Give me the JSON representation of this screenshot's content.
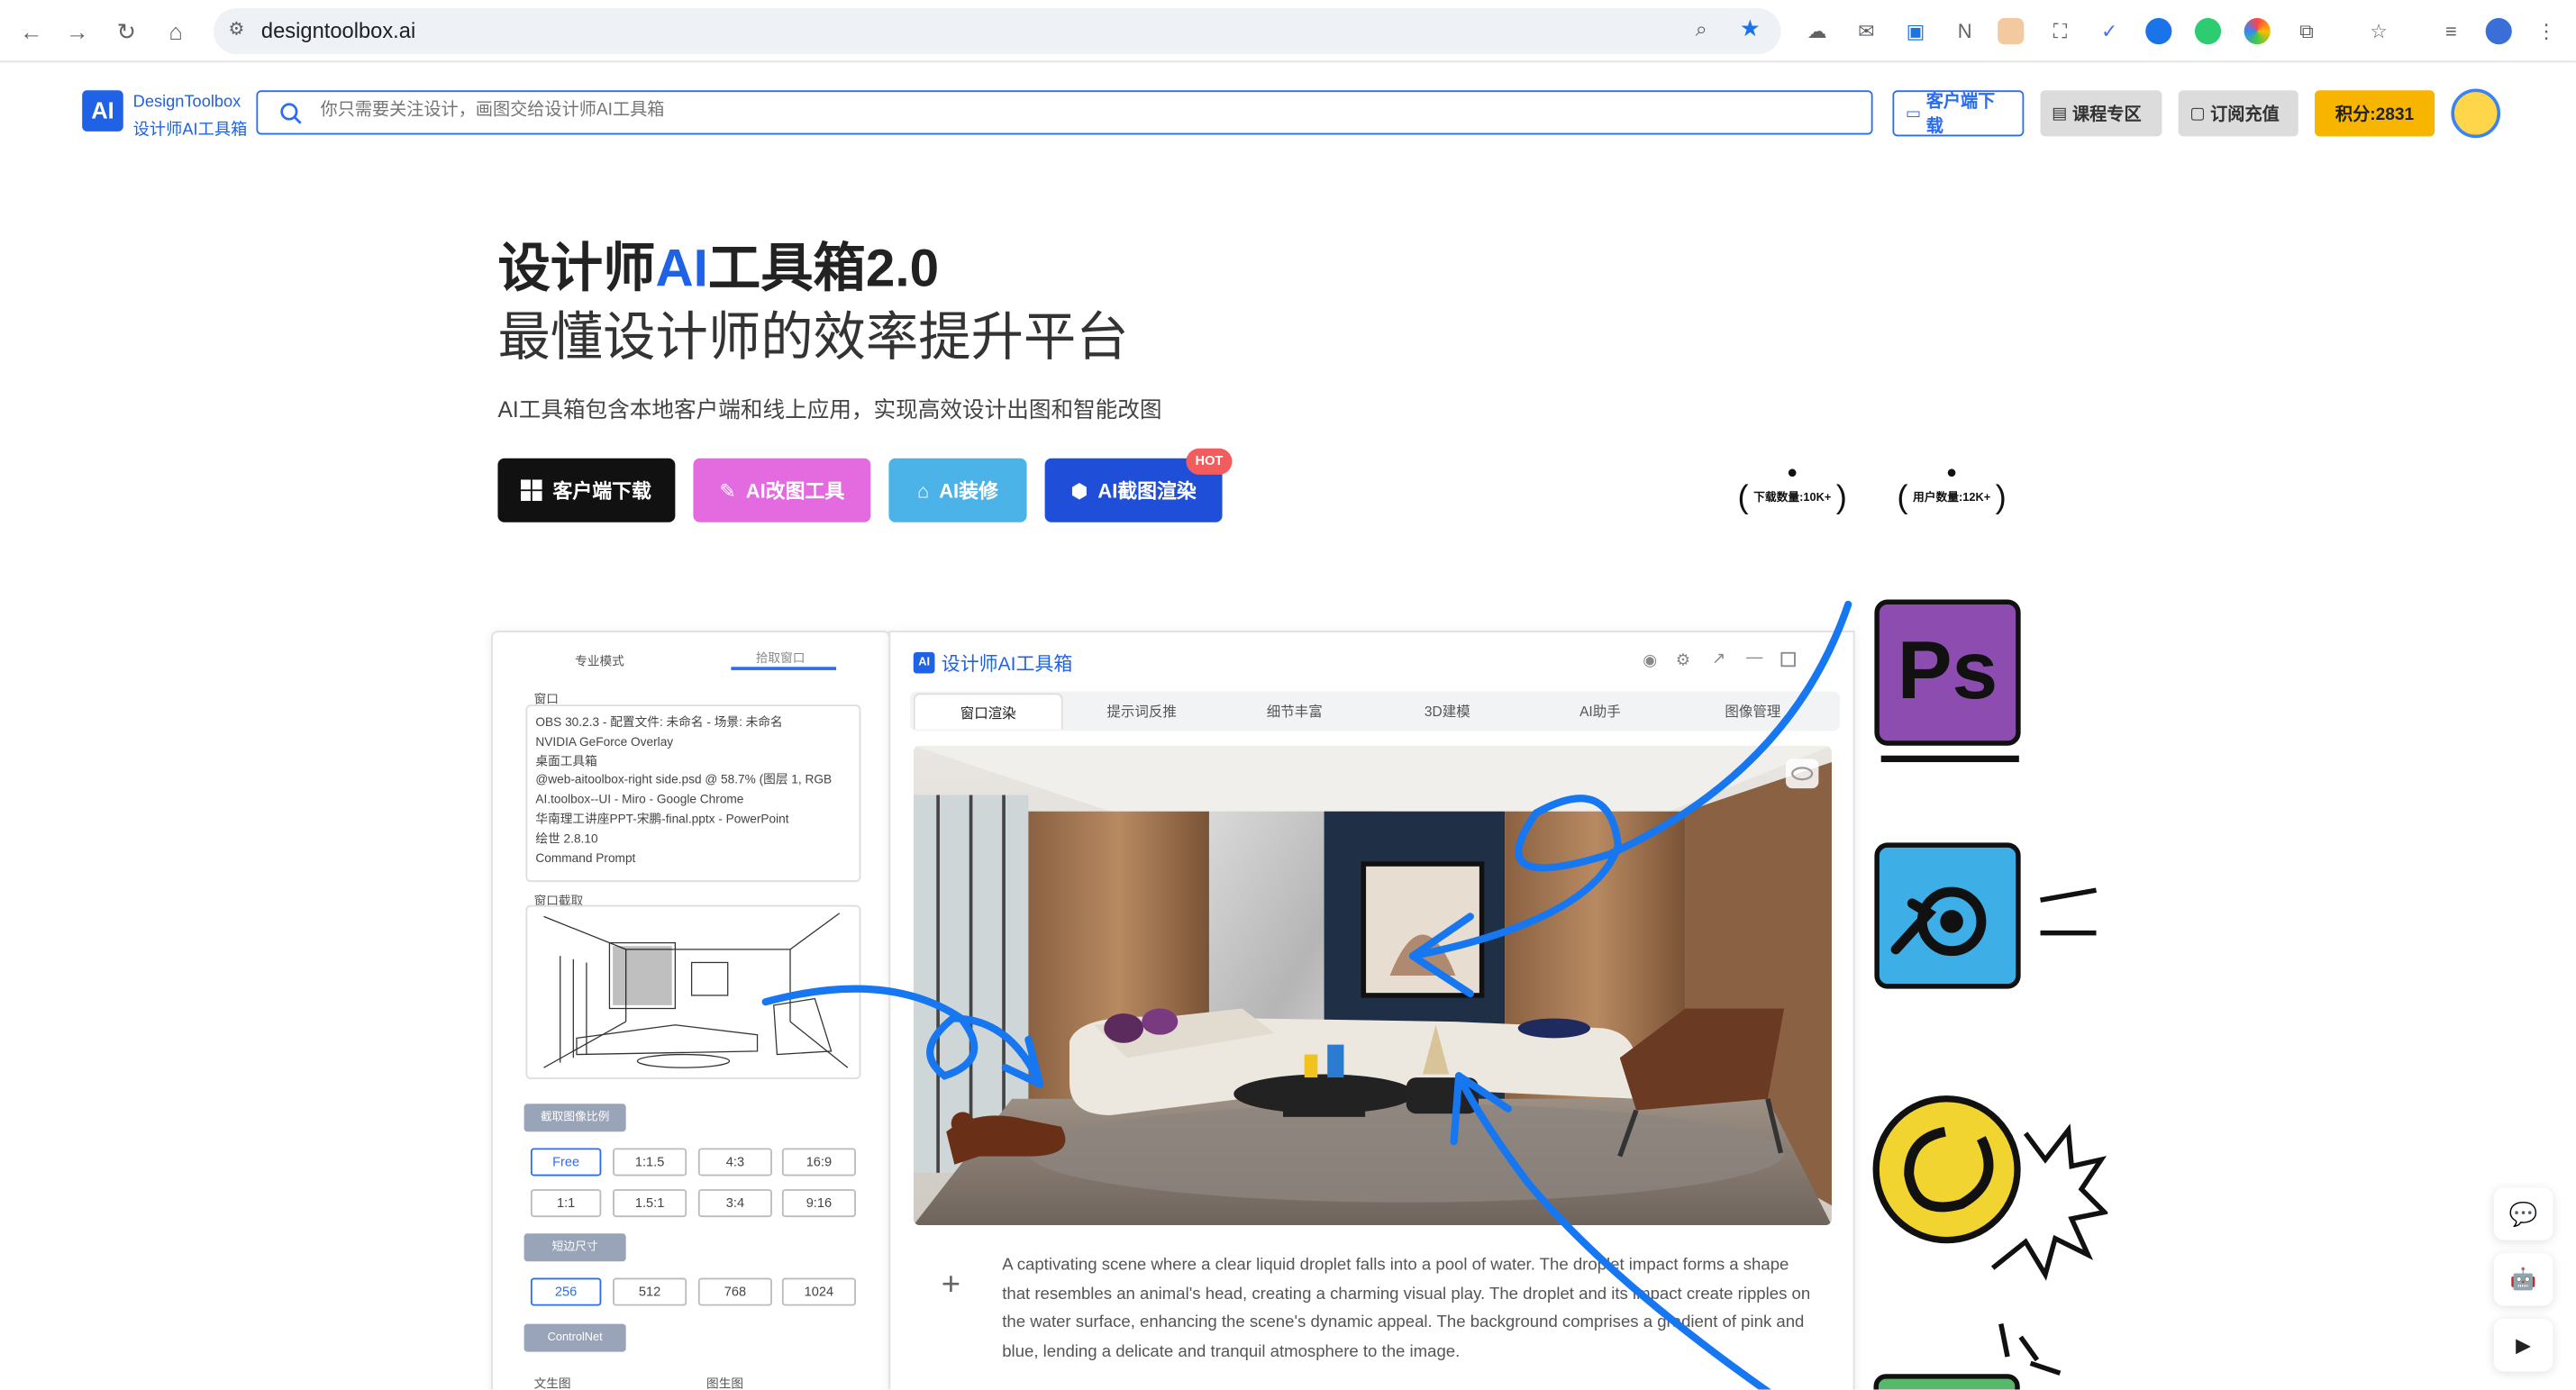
{
  "browser": {
    "url": "designtoolbox.ai",
    "icons": [
      "back-icon",
      "forward-icon",
      "reload-icon",
      "home-icon"
    ]
  },
  "header": {
    "logo_mark": "AI",
    "logo_line1": "DesignToolbox",
    "logo_line2": "设计师AI工具箱",
    "search_placeholder": "你只需要关注设计，画图交给设计师AI工具箱",
    "buttons": {
      "download": "客户端下载",
      "courses": "课程专区",
      "subscribe": "订阅充值",
      "points": "积分:2831"
    }
  },
  "hero": {
    "title_prefix": "设计师",
    "title_ai": "AI",
    "title_suffix": "工具箱2.0",
    "subtitle": "最懂设计师的效率提升平台",
    "description": "AI工具箱包含本地客户端和线上应用，实现高效设计出图和智能改图",
    "ctas": {
      "client": "客户端下载",
      "edit": "AI改图工具",
      "decor": "AI装修",
      "render": "AI截图渲染",
      "hot": "HOT"
    },
    "stats": {
      "downloads": "下载数量:10K+",
      "users": "用户数量:12K+"
    }
  },
  "app": {
    "left_tabs": {
      "pro": "专业模式",
      "capture": "拾取窗口"
    },
    "window_label": "窗口",
    "windows": [
      "OBS 30.2.3 - 配置文件: 未命名 - 场景: 未命名",
      "NVIDIA GeForce Overlay",
      "桌面工具箱",
      "@web-aitoolbox-right side.psd @ 58.7% (图层 1, RGB",
      "AI.toolbox--UI - Miro - Google Chrome",
      "华南理工讲座PPT-宋鹏-final.pptx - PowerPoint",
      "绘世 2.8.10",
      "Command Prompt"
    ],
    "capture_label": "窗口截取",
    "ratio_label": "截取图像比例",
    "ratios": [
      "Free",
      "1:1.5",
      "4:3",
      "16:9",
      "1:1",
      "1.5:1",
      "3:4",
      "9:16"
    ],
    "size_label": "短边尺寸",
    "sizes": [
      "256",
      "512",
      "768",
      "1024"
    ],
    "controlnet": "ControlNet",
    "bottom_labels": [
      "文生图",
      "图生图"
    ],
    "main_logo_mark": "AI",
    "main_title": "设计师AI工具箱",
    "tabs": [
      "窗口渲染",
      "提示词反推",
      "细节丰富",
      "3D建模",
      "AI助手",
      "图像管理"
    ],
    "prompt": "A captivating scene where a clear liquid droplet falls into a pool of water. The droplet impact forms a shape that resembles an animal's head, creating a charming visual play. The droplet and its impact create ripples on the water surface, enhancing the scene's dynamic appeal. The background comprises a gradient of pink and blue, lending a delicate and tranquil atmosphere to the image.",
    "add_symbol": "+"
  },
  "integrations": {
    "ps_label": "Ps"
  },
  "colors": {
    "brand_blue": "#1f62e6",
    "points_yellow": "#f7b500",
    "edit_pink": "#e46ae0",
    "decor_blue": "#4bb3e8",
    "render_blue": "#1f4fd8",
    "arrow_blue": "#1677f0"
  }
}
